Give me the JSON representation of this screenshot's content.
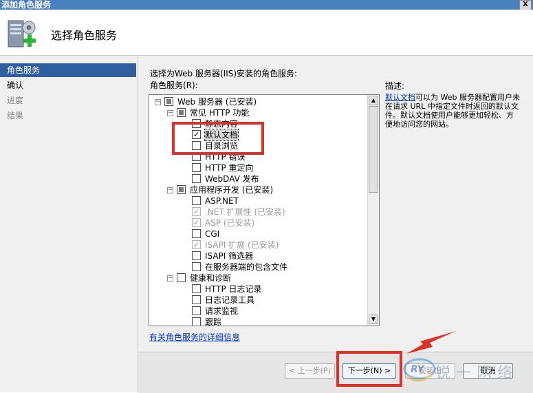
{
  "window": {
    "title": "添加角色服务",
    "close_label": "X"
  },
  "header": {
    "title": "选择角色服务"
  },
  "sidebar": {
    "items": [
      {
        "label": "角色服务",
        "state": "active"
      },
      {
        "label": "确认",
        "state": "bold"
      },
      {
        "label": "进度",
        "state": "normal"
      },
      {
        "label": "结果",
        "state": "normal"
      }
    ]
  },
  "main": {
    "intro": "选择为Web 服务器(IIS)安装的角色服务:",
    "tree_label": "角色服务(R):",
    "tree": [
      {
        "label": "Web 服务器  (已安装)",
        "level": 0,
        "expander": "⊟",
        "check": "partial",
        "grey": false
      },
      {
        "label": "常见 HTTP 功能",
        "level": 1,
        "expander": "⊟",
        "check": "partial",
        "grey": false
      },
      {
        "label": "静态内容",
        "level": 2,
        "check": "none",
        "grey": false
      },
      {
        "label": "默认文档",
        "level": 2,
        "check": "checked",
        "grey": false,
        "selected": true
      },
      {
        "label": "目录浏览",
        "level": 2,
        "check": "none",
        "grey": false
      },
      {
        "label": "HTTP 错误",
        "level": 2,
        "check": "none",
        "grey": false
      },
      {
        "label": "HTTP 重定向",
        "level": 2,
        "check": "none",
        "grey": false
      },
      {
        "label": "WebDAV 发布",
        "level": 2,
        "check": "none",
        "grey": false
      },
      {
        "label": "应用程序开发  (已安装)",
        "level": 1,
        "expander": "⊟",
        "check": "partial",
        "grey": false
      },
      {
        "label": "ASP.NET",
        "level": 2,
        "check": "none",
        "grey": false
      },
      {
        "label": ".NET 扩展性  (已安装)",
        "level": 2,
        "check": "checked",
        "grey": true
      },
      {
        "label": "ASP  (已安装)",
        "level": 2,
        "check": "checked",
        "grey": true
      },
      {
        "label": "CGI",
        "level": 2,
        "check": "none",
        "grey": false
      },
      {
        "label": "ISAPI 扩展  (已安装)",
        "level": 2,
        "check": "checked",
        "grey": true
      },
      {
        "label": "ISAPI 筛选器",
        "level": 2,
        "check": "none",
        "grey": false
      },
      {
        "label": "在服务器端的包含文件",
        "level": 2,
        "check": "none",
        "grey": false
      },
      {
        "label": "健康和诊断",
        "level": 1,
        "expander": "⊟",
        "check": "none",
        "grey": false
      },
      {
        "label": "HTTP 日志记录",
        "level": 2,
        "check": "none",
        "grey": false
      },
      {
        "label": "日志记录工具",
        "level": 2,
        "check": "none",
        "grey": false
      },
      {
        "label": "请求监视",
        "level": 2,
        "check": "none",
        "grey": false
      },
      {
        "label": "跟踪",
        "level": 2,
        "check": "none",
        "grey": false
      }
    ],
    "more_info_link": "有关角色服务的详细信息",
    "description": {
      "heading": "描述:",
      "link": "默认文档",
      "text": "可以为 Web 服务器配置用户未在请求 URL 中指定文件时返回的默认文件。默认文档使用户能够更加轻松、方便地访问您的网站。"
    }
  },
  "footer": {
    "prev_label": "< 上一步(P)",
    "next_label": "下一步(N) >",
    "install_label": "安装(I)",
    "cancel_label": "取消"
  },
  "watermark": {
    "logo": "RY",
    "text": "锐一网络"
  },
  "colors": {
    "title_bar": "#4a7fc0",
    "selection": "#2f5f9e",
    "highlight_box": "#e0302a",
    "link": "#0033cc"
  }
}
